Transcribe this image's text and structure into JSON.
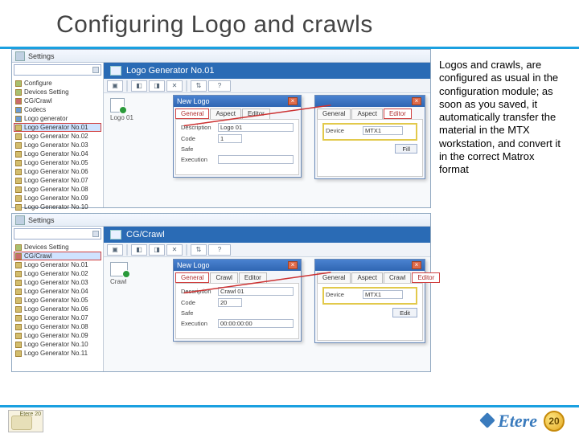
{
  "title": "Configuring Logo and crawls",
  "explanation": "Logos and crawls, are configured as usual in the configuration module; as soon as you saved, it automatically transfer the material in the MTX workstation, and convert it in the correct Matrox format",
  "win1": {
    "title": "Settings",
    "panel_title": "Logo Generator No.01",
    "tree": [
      {
        "label": "Configure",
        "kind": "grp"
      },
      {
        "label": "Devices Setting",
        "kind": "grp"
      },
      {
        "label": "CG/Crawl",
        "kind": "red"
      },
      {
        "label": "Codecs",
        "kind": "blue"
      },
      {
        "label": "Logo generator",
        "kind": "blue",
        "sel": false
      },
      {
        "label": "Logo Generator No.01",
        "kind": "",
        "sel": true,
        "hl": true
      },
      {
        "label": "Logo Generator No.02",
        "kind": ""
      },
      {
        "label": "Logo Generator No.03",
        "kind": ""
      },
      {
        "label": "Logo Generator No.04",
        "kind": ""
      },
      {
        "label": "Logo Generator No.05",
        "kind": ""
      },
      {
        "label": "Logo Generator No.06",
        "kind": ""
      },
      {
        "label": "Logo Generator No.07",
        "kind": ""
      },
      {
        "label": "Logo Generator No.08",
        "kind": ""
      },
      {
        "label": "Logo Generator No.09",
        "kind": ""
      },
      {
        "label": "Logo Generator No.10",
        "kind": ""
      }
    ],
    "logo_label": "Logo 01",
    "dlg_center": {
      "title": "New Logo",
      "tabs": [
        "General",
        "Aspect",
        "Editor"
      ],
      "desc_label": "Description",
      "desc_value": "Logo 01",
      "code_label": "Code",
      "code_value": "1",
      "safe_label": "Safe",
      "exec_label": "Execution"
    },
    "dlg_right": {
      "tabs": [
        "General",
        "Aspect",
        "Editor"
      ],
      "device_label": "Device",
      "device_value": "MTX1",
      "fill_btn": "Fill"
    }
  },
  "win2": {
    "title": "Settings",
    "panel_title": "CG/Crawl",
    "tree": [
      {
        "label": "Devices Setting",
        "kind": "grp"
      },
      {
        "label": "CG/Crawl",
        "kind": "red",
        "sel": true,
        "hl": true
      },
      {
        "label": "Logo Generator No.01",
        "kind": ""
      },
      {
        "label": "Logo Generator No.02",
        "kind": ""
      },
      {
        "label": "Logo Generator No.03",
        "kind": ""
      },
      {
        "label": "Logo Generator No.04",
        "kind": ""
      },
      {
        "label": "Logo Generator No.05",
        "kind": ""
      },
      {
        "label": "Logo Generator No.06",
        "kind": ""
      },
      {
        "label": "Logo Generator No.07",
        "kind": ""
      },
      {
        "label": "Logo Generator No.08",
        "kind": ""
      },
      {
        "label": "Logo Generator No.09",
        "kind": ""
      },
      {
        "label": "Logo Generator No.10",
        "kind": ""
      },
      {
        "label": "Logo Generator No.11",
        "kind": ""
      }
    ],
    "crawl_label": "Crawl",
    "dlg_center": {
      "title": "New Logo",
      "tabs": [
        "General",
        "Crawl",
        "Editor"
      ],
      "desc_label": "Description",
      "desc_value": "Crawl 01",
      "code_label": "Code",
      "code_value": "20",
      "safe_label": "Safe",
      "exec_label": "Execution",
      "exec_value": "00:00:00:00"
    },
    "dlg_right": {
      "tabs": [
        "General",
        "Aspect",
        "Crawl",
        "Editor"
      ],
      "device_label": "Device",
      "device_value": "MTX1",
      "edit_btn": "Edit"
    }
  },
  "footer": {
    "badge_text": "Etere 20",
    "brand": "Etere",
    "medal": "20"
  }
}
